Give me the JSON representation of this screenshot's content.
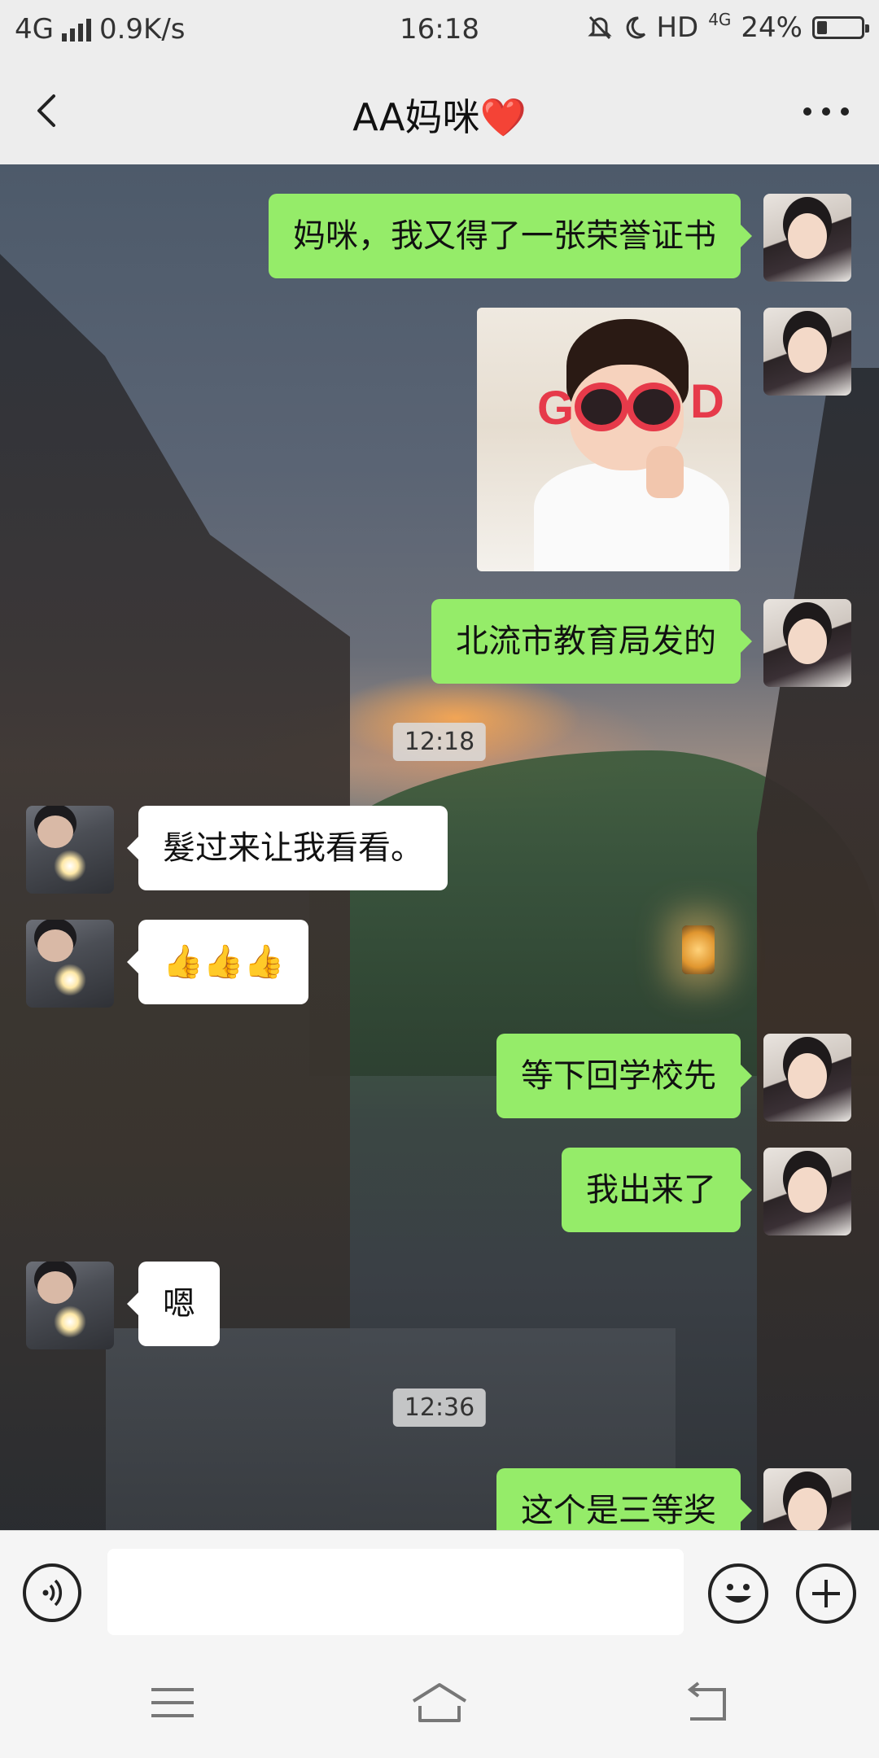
{
  "status_bar": {
    "network": "4G",
    "speed": "0.9K/s",
    "time": "16:18",
    "hd": "HD",
    "net2": "4G",
    "battery_text": "24%",
    "battery_level": 0.24
  },
  "header": {
    "title": "AA妈咪",
    "heart": "❤️"
  },
  "messages": {
    "m1": "妈咪，我又得了一张荣誉证书",
    "m3": "北流市教育局发的",
    "t1": "12:18",
    "m4": "髮过来让我看看。",
    "m5": "👍👍👍",
    "m6": "等下回学校先",
    "m7": "我出来了",
    "m8": "嗯",
    "t2": "12:36",
    "m9": "这个是三等奖"
  },
  "sticker": {
    "g": "G",
    "d": "D"
  },
  "input": {
    "placeholder": ""
  },
  "icons": {
    "back": "chevron-left-icon",
    "more": "more-dots-icon",
    "voice": "voice-icon",
    "emoji": "emoji-icon",
    "plus": "plus-icon",
    "menu": "menu-icon",
    "home": "home-icon",
    "back_sys": "back-arrow-icon"
  },
  "colors": {
    "outgoing_bubble": "#95ec69",
    "incoming_bubble": "#ffffff",
    "bar_background": "#ededed"
  }
}
